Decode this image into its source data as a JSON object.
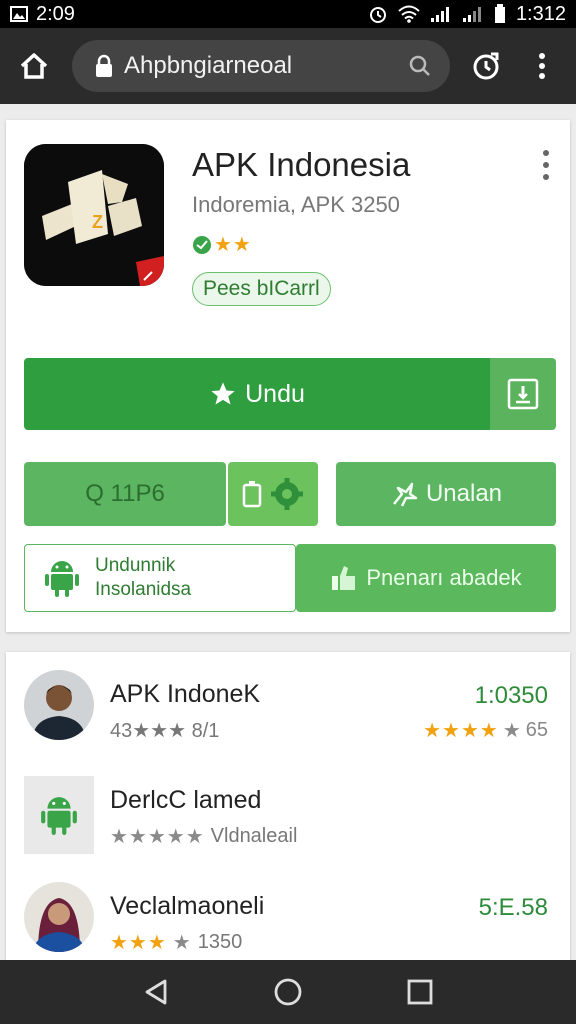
{
  "status_bar": {
    "time_left": "2:09",
    "time_right": "1:312",
    "icons": [
      "gallery-icon",
      "alarm-icon",
      "wifi-icon",
      "signal-icon",
      "signal-icon",
      "battery-icon"
    ]
  },
  "browser": {
    "url": "Ahpbngiarneoal",
    "icons": [
      "home-icon",
      "lock-icon",
      "search-icon",
      "tabs-icon",
      "overflow-menu-icon"
    ]
  },
  "app": {
    "title": "APK Indonesia",
    "subtitle": "Indoremia, APK 3250",
    "chip": "Pees bICarrl",
    "install_label": "Undu",
    "button_a": "Q 11P6",
    "button_c": "Unalan",
    "button_d_line1": "Undunnik",
    "button_d_line2": "Insolanidsa",
    "button_e": "Pnenarı abadek",
    "colors": {
      "green_dark": "#2f9e3f",
      "green_mid": "#5cb561",
      "green_light": "#6cc35d",
      "star": "#f1a20e"
    }
  },
  "list": {
    "items": [
      {
        "title": "APK IndoneK",
        "sub_text": "43★★★ 8/1",
        "right": "1:0350",
        "right_sub": "65"
      },
      {
        "title": "DerlcC lamed",
        "sub_text": "Vldnaleail",
        "right": "",
        "right_sub": ""
      },
      {
        "title": "Veclalmaoneli",
        "sub_text": "1350",
        "right": "5:E.58",
        "right_sub": ""
      }
    ]
  },
  "nav": {
    "icons": [
      "back-icon",
      "home-circle-icon",
      "recents-icon"
    ]
  }
}
